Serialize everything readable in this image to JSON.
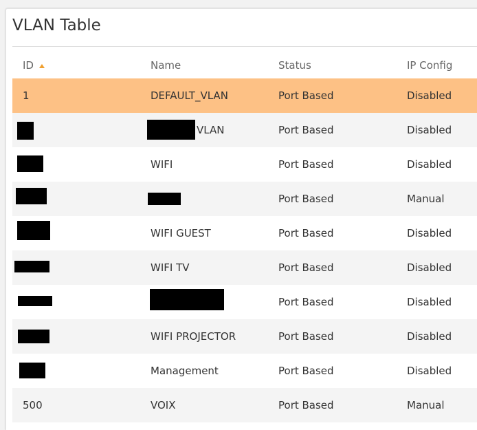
{
  "panel": {
    "title": "VLAN Table"
  },
  "table": {
    "columns": [
      "ID",
      "Name",
      "Status",
      "IP Config"
    ],
    "sort_column": "ID",
    "sort_direction": "ascending",
    "rows": [
      {
        "id": "1",
        "name": "DEFAULT_VLAN",
        "status": "Port Based",
        "ip_config": "Disabled"
      },
      {
        "id": "",
        "name": "VLAN",
        "status": "Port Based",
        "ip_config": "Disabled"
      },
      {
        "id": "",
        "name": "WIFI",
        "status": "Port Based",
        "ip_config": "Disabled"
      },
      {
        "id": "",
        "name": "",
        "status": "Port Based",
        "ip_config": "Manual"
      },
      {
        "id": "",
        "name": "WIFI GUEST",
        "status": "Port Based",
        "ip_config": "Disabled"
      },
      {
        "id": "",
        "name": "WIFI TV",
        "status": "Port Based",
        "ip_config": "Disabled"
      },
      {
        "id": "",
        "name": "",
        "status": "Port Based",
        "ip_config": "Disabled"
      },
      {
        "id": "",
        "name": "WIFI PROJECTOR",
        "status": "Port Based",
        "ip_config": "Disabled"
      },
      {
        "id": "",
        "name": "Management",
        "status": "Port Based",
        "ip_config": "Disabled"
      },
      {
        "id": "500",
        "name": "VOIX",
        "status": "Port Based",
        "ip_config": "Manual"
      }
    ]
  },
  "colors": {
    "selected_row": "#fdc185",
    "alt_row": "#f4f4f4",
    "sort_arrow": "#f0a030"
  },
  "icons": {
    "sort": "sort-ascending-icon"
  }
}
